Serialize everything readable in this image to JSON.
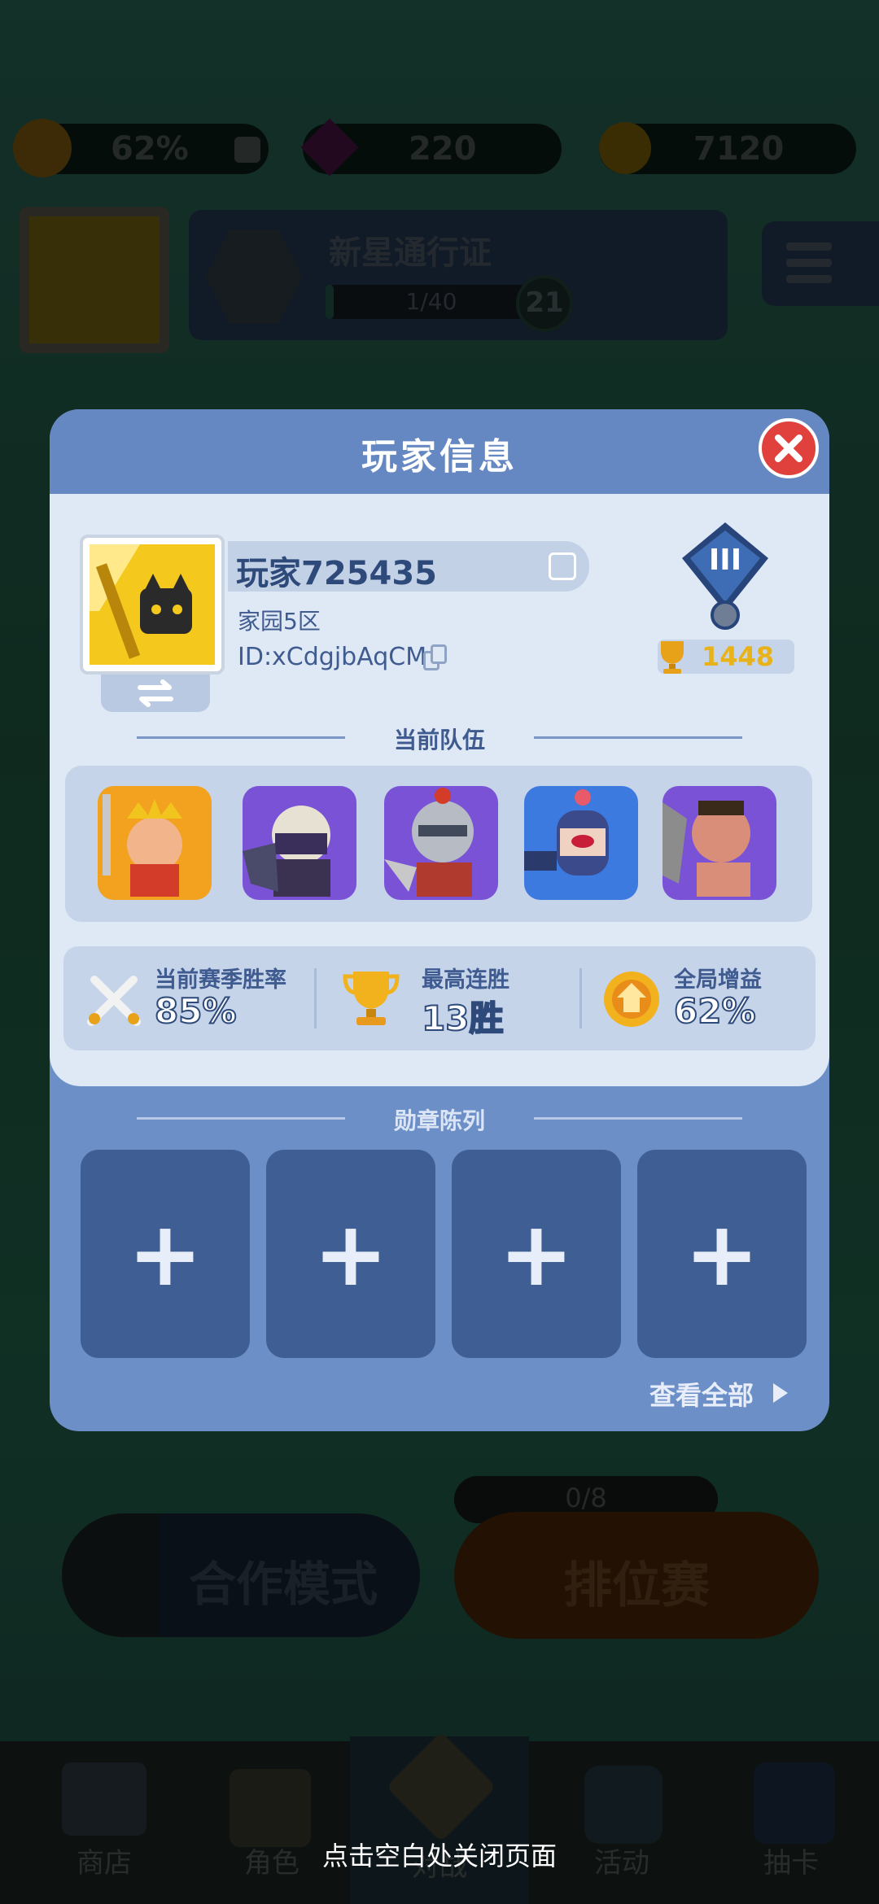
{
  "resources": {
    "home_boost": "62%",
    "gems": "220",
    "coins": "7120"
  },
  "pass": {
    "title": "新星通行证",
    "progress": "1/40",
    "progress_fraction": 0.025,
    "level": "21"
  },
  "modal": {
    "title": "玩家信息",
    "player_name": "玩家725435",
    "server": "家园5区",
    "player_id": "ID:xCdgjbAqCM",
    "rank_numeral": "III",
    "trophies": "1448",
    "team_section_label": "当前队伍",
    "heroes": [
      {
        "name": "king-hero",
        "frame_color": "#f2a21e"
      },
      {
        "name": "dark-knight-hero",
        "frame_color": "#7a52d6"
      },
      {
        "name": "armored-knight-hero",
        "frame_color": "#7a52d6"
      },
      {
        "name": "bomb-guard-hero",
        "frame_color": "#3d7ae0"
      },
      {
        "name": "orc-warrior-hero",
        "frame_color": "#7a52d6"
      }
    ],
    "stats": [
      {
        "label": "当前赛季胜率",
        "value": "85%",
        "icon": "crossed-swords-icon"
      },
      {
        "label": "最高连胜",
        "value": "13胜",
        "icon": "trophy-icon"
      },
      {
        "label": "全局增益",
        "value": "62%",
        "icon": "home-boost-icon"
      }
    ],
    "badge_section_label": "勋章陈列",
    "badge_slot_symbol": "+",
    "view_all": "查看全部"
  },
  "lobby": {
    "coop_mode": "合作模式",
    "ranked": "排位赛",
    "ticket_count": "0/8"
  },
  "bottom_nav": [
    "商店",
    "角色",
    "对战",
    "活动",
    "抽卡"
  ],
  "close_hint": "点击空白处关闭页面",
  "colors": {
    "modal_bg": "#6b8fc6",
    "inner_bg": "#dfe8f5",
    "close_red": "#e0413d",
    "slot_bg": "#3f5f94"
  }
}
